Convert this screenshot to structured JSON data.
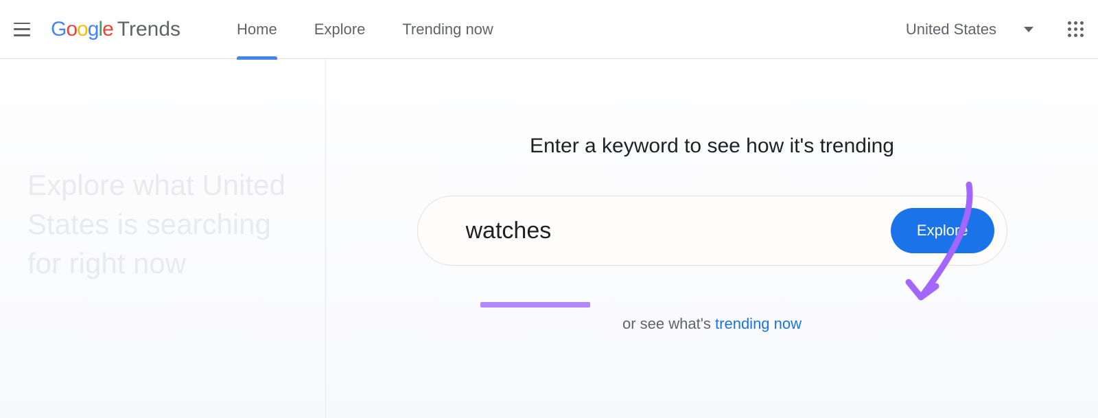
{
  "header": {
    "logo_brand": "Google",
    "logo_product": "Trends",
    "nav": {
      "home": "Home",
      "explore": "Explore",
      "trending_now": "Trending now"
    },
    "country_selector": {
      "selected": "United States"
    }
  },
  "main": {
    "hero_text": "Explore what United States is searching for right now",
    "prompt": "Enter a keyword to see how it's trending",
    "search": {
      "value": "watches",
      "button_label": "Explore"
    },
    "or_line_prefix": "or see what's ",
    "or_line_link": "trending now"
  },
  "annotations": {
    "arrow_color": "#a366ff",
    "underline_color": "#b388ff"
  }
}
